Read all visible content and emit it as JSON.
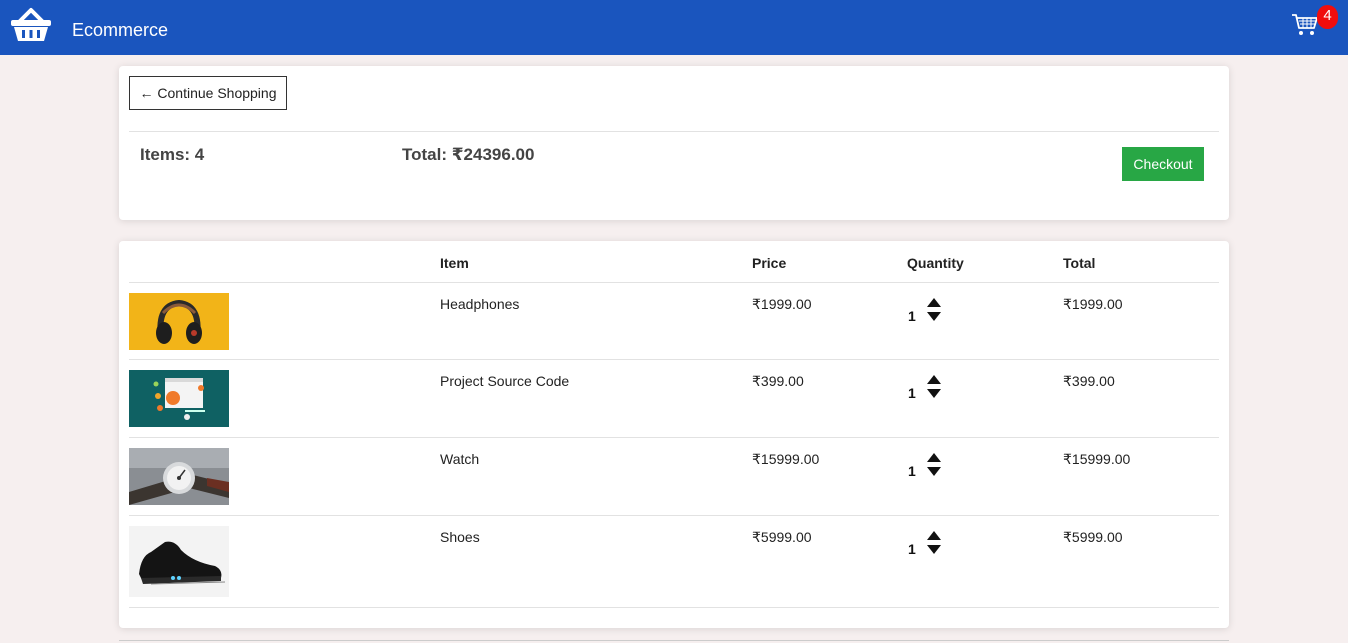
{
  "header": {
    "title": "Ecommerce",
    "brand_icon": "basket-icon",
    "cart_icon": "cart-icon",
    "cart_count": "4",
    "bar_color": "#1a55be",
    "badge_color": "#f00d0d"
  },
  "summary": {
    "continue_label": "← Continue Shopping",
    "items_label": "Items: 4",
    "total_label": "Total: ₹24396.00",
    "checkout_label": "Checkout",
    "checkout_color": "#28a745"
  },
  "table": {
    "headers": {
      "item": "Item",
      "price": "Price",
      "quantity": "Quantity",
      "total": "Total"
    },
    "rows": [
      {
        "name": "Headphones",
        "price": "₹1999.00",
        "quantity": "1",
        "total": "₹1999.00",
        "image": "headphones-image"
      },
      {
        "name": "Project Source Code",
        "price": "₹399.00",
        "quantity": "1",
        "total": "₹399.00",
        "image": "source-code-image"
      },
      {
        "name": "Watch",
        "price": "₹15999.00",
        "quantity": "1",
        "total": "₹15999.00",
        "image": "watch-image"
      },
      {
        "name": "Shoes",
        "price": "₹5999.00",
        "quantity": "1",
        "total": "₹5999.00",
        "image": "shoes-image"
      }
    ]
  }
}
